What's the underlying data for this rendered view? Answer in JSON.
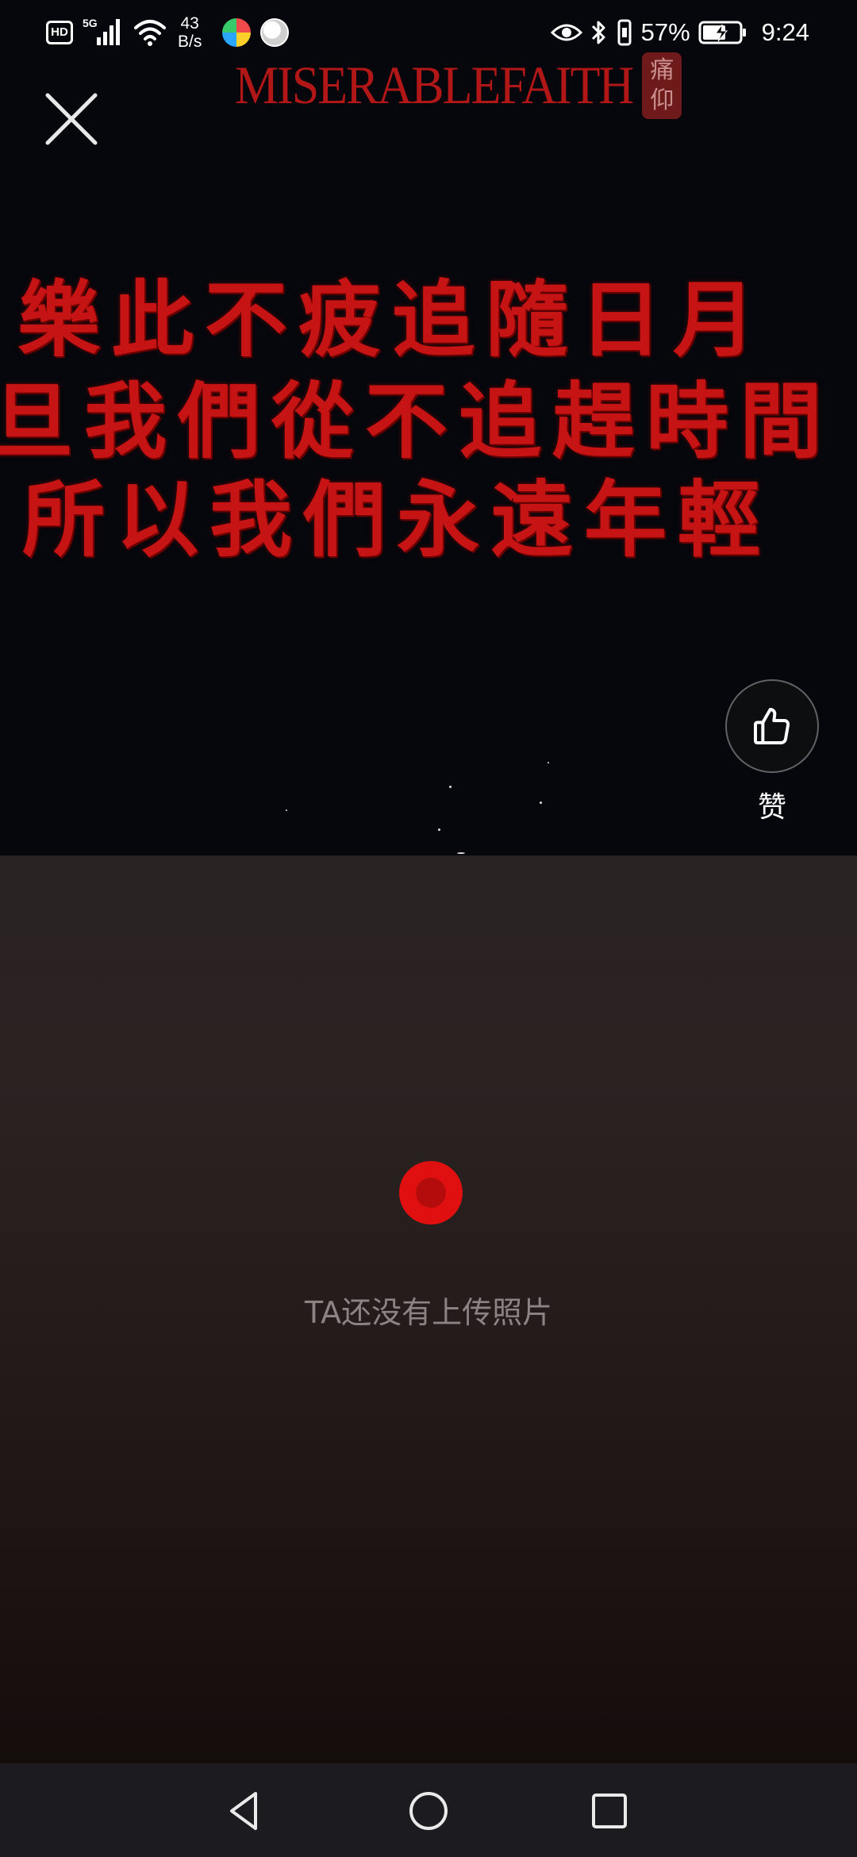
{
  "status_bar": {
    "hd": "HD",
    "network_type": "5G",
    "net_speed_value": "43",
    "net_speed_unit": "B/s",
    "battery_percent": "57%",
    "time": "9:24",
    "icons": [
      "hd-icon",
      "signal-icon",
      "wifi-icon",
      "app-icon-colorful",
      "app-icon-ball",
      "eye-icon",
      "bluetooth-icon",
      "vibrate-icon",
      "battery-charging-icon"
    ]
  },
  "media": {
    "brand_text": "MISERABLEFAITH",
    "brand_seal": "痛仰",
    "lyrics": [
      "樂此不疲追隨日月",
      "旦我們從不追趕時間",
      "所以我們永遠年輕"
    ],
    "lyric_color": "#c61313"
  },
  "actions": {
    "close_icon": "close-icon",
    "like_icon": "thumbs-up-icon",
    "like_label": "赞"
  },
  "empty_state": {
    "icon": "record-dot-icon",
    "message": "TA还没有上传照片",
    "accent": "#e01010"
  },
  "nav_bar": {
    "icons": [
      "back-icon",
      "home-icon",
      "recent-apps-icon"
    ]
  }
}
